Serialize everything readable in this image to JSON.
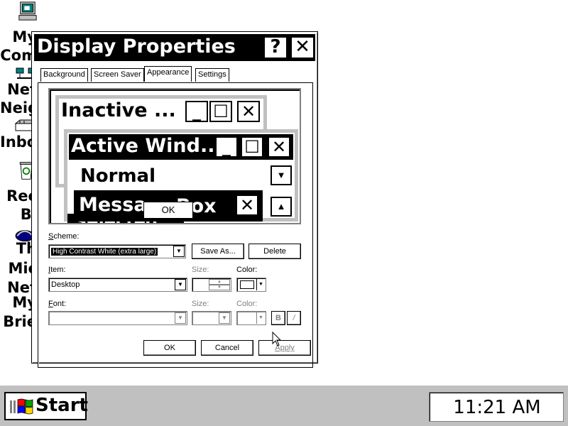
{
  "desktop": {
    "icons": [
      {
        "label_lines": [
          "My",
          "Com"
        ]
      },
      {
        "label_lines": [
          "Net",
          "Neig"
        ]
      },
      {
        "label_lines": [
          "Inbo"
        ]
      },
      {
        "label_lines": [
          "Rec",
          "Bi"
        ]
      },
      {
        "label_lines": [
          "Th",
          "Mic",
          "Net"
        ]
      },
      {
        "label_lines": [
          "My",
          "Brie"
        ]
      }
    ]
  },
  "dialog": {
    "title": "Display Properties",
    "help_glyph": "?",
    "close_glyph": "✕",
    "tabs": [
      "Background",
      "Screen Saver",
      "Appearance",
      "Settings"
    ],
    "selected_tab": "Appearance",
    "preview": {
      "inactive_title": "Inactive ...",
      "active_title": "Active Wind...",
      "normal_text": "Normal",
      "message_title": "Messa",
      "message_title_tail": "Box",
      "ok_label": "OK",
      "selected_text": "Selected"
    },
    "scheme": {
      "label_u": "S",
      "label_rest": "cheme:",
      "value": "High Contrast White (extra large)",
      "save_as": "Save As...",
      "delete": "Delete"
    },
    "item": {
      "label_u": "I",
      "label_rest": "tem:",
      "value": "Desktop",
      "size_label": "Size:",
      "color_label": "Color:"
    },
    "font": {
      "label_u": "F",
      "label_rest": "ont:",
      "value": "",
      "size_label": "Size:",
      "color_label": "Color:",
      "bold": "B",
      "italic": "/"
    },
    "buttons": {
      "ok": "OK",
      "cancel": "Cancel",
      "apply": "Apply"
    }
  },
  "taskbar": {
    "start_label": "Start",
    "clock": "11:21 AM"
  }
}
